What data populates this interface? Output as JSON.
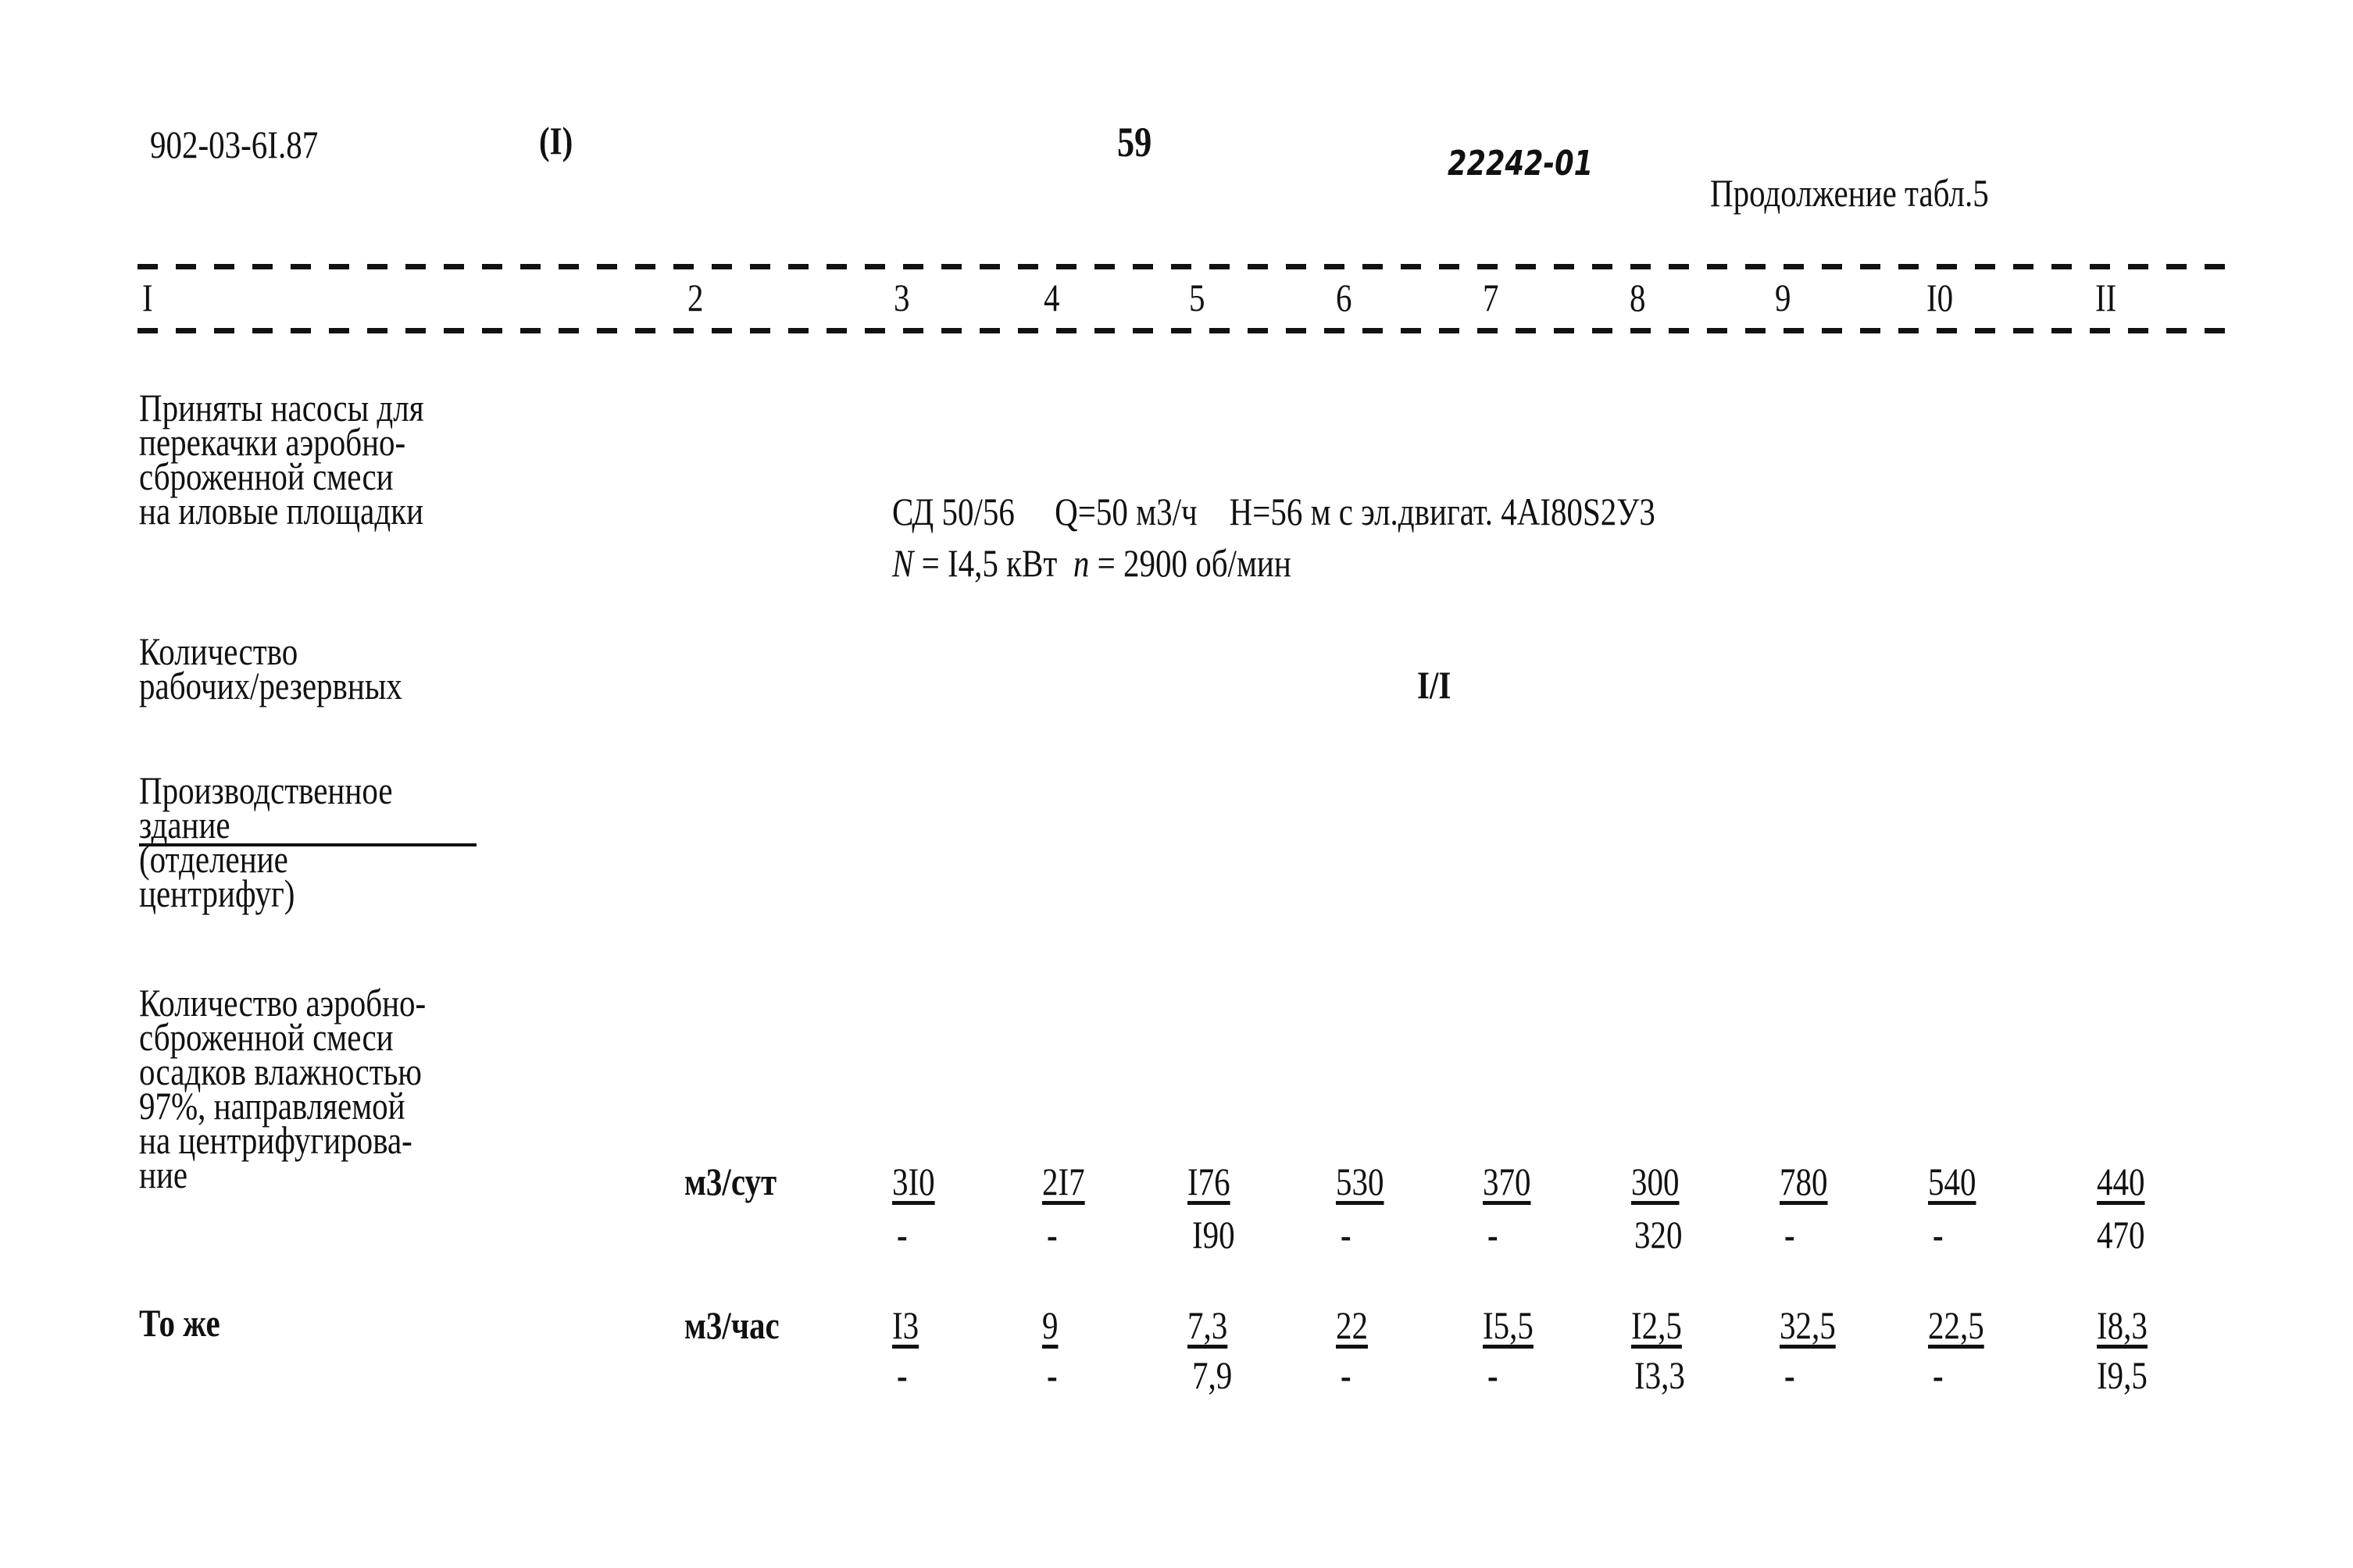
{
  "header": {
    "doc_code": "902-03-6I.87",
    "volume": "(I)",
    "page_number": "59",
    "inventory_number": "22242-01",
    "table_caption": "Продолжение табл.5"
  },
  "column_numbers": [
    "I",
    "2",
    "3",
    "4",
    "5",
    "6",
    "7",
    "8",
    "9",
    "I0",
    "II"
  ],
  "rows": {
    "pumps": {
      "label": "Приняты насосы для\nперекачки аэробно-\nсброженной смеси\nна иловые площадки",
      "spec_line1": "СД 50/56     Q=50 м3/ч    H=56 м с эл.двигат. 4AI80S2У3",
      "spec_line2_n_symbol": "N",
      "spec_line2_power": " = I4,5 кВт  ",
      "spec_line2_rpm_symbol": "n",
      "spec_line2_rpm": " = 2900 об/мин"
    },
    "count": {
      "label": "Количество\nрабочих/резервных",
      "value": "I/I"
    },
    "building": {
      "label_line1": "Производственное",
      "label_line2": "здание",
      "label_line3": "(отделение\nцентрифуг)"
    },
    "quantity_day": {
      "label": "Количество аэробно-\nсброженной смеси\nосадков влажностью\n97%, направляемой\nна центрифугирова-\nние",
      "unit": "м3/сут",
      "values_top": [
        "3I0",
        "2I7",
        "I76",
        "530",
        "370",
        "300",
        "780",
        "540",
        "440"
      ],
      "values_bottom": [
        "-",
        "-",
        "I90",
        "-",
        "-",
        "320",
        "-",
        "-",
        "470"
      ]
    },
    "quantity_hour": {
      "label": "То же",
      "unit": "м3/час",
      "values_top": [
        "I3",
        "9",
        "7,3",
        "22",
        "I5,5",
        "I2,5",
        "32,5",
        "22,5",
        "I8,3"
      ],
      "values_bottom": [
        "-",
        "-",
        "7,9",
        "-",
        "-",
        "I3,3",
        "-",
        "-",
        "I9,5"
      ]
    }
  }
}
